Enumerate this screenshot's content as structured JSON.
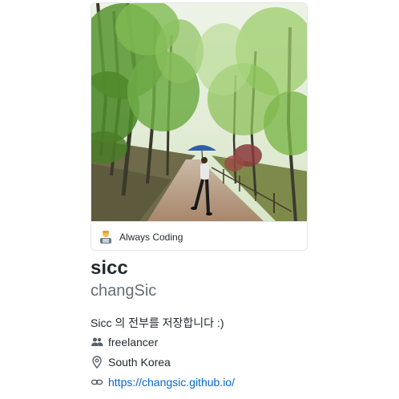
{
  "status": {
    "emoji_icon": "technologist-emoji-icon",
    "text": "Always Coding"
  },
  "profile": {
    "name": "sicc",
    "login": "changSic",
    "bio": "Sicc 의 전부를 저장합니다 :)"
  },
  "details": {
    "company": {
      "icon": "people-icon",
      "text": "freelancer"
    },
    "location": {
      "icon": "location-icon",
      "text": "South Korea"
    },
    "website": {
      "icon": "link-icon",
      "text": "https://changsic.github.io/"
    }
  },
  "colors": {
    "link": "#0366d6",
    "muted": "#666e75",
    "text": "#24292e",
    "border": "#e1e4e8"
  }
}
